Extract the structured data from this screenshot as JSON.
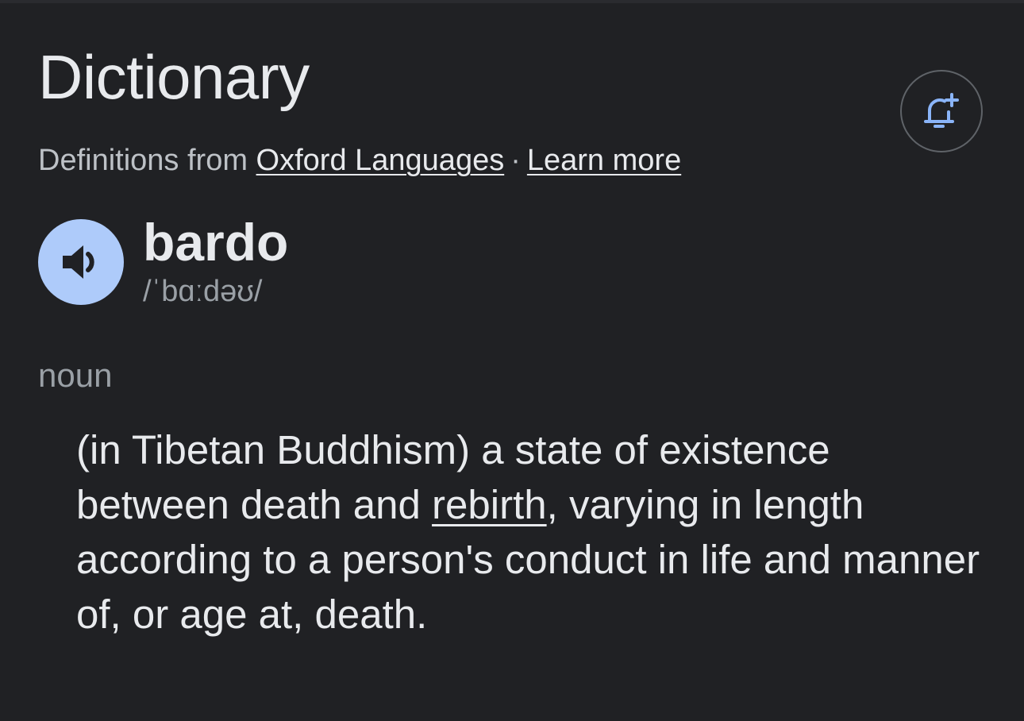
{
  "card": {
    "title": "Dictionary",
    "source_prefix": "Definitions from",
    "source_link": "Oxford Languages",
    "separator": "·",
    "learn_more": "Learn more",
    "notify_icon": "bell-plus-icon",
    "speaker_icon": "speaker-icon"
  },
  "entry": {
    "word": "bardo",
    "phonetic": "/ˈbɑːdəʊ/",
    "part_of_speech": "noun",
    "definition_before": "(in Tibetan Buddhism) a state of existence between death and ",
    "definition_link": "rebirth",
    "definition_after": ", varying in length according to a person's conduct in life and manner of, or age at, death."
  },
  "colors": {
    "background": "#202124",
    "text_primary": "#e8eaed",
    "text_secondary": "#9aa0a6",
    "accent_blue": "#aecbfa",
    "icon_blue": "#8ab4f8"
  }
}
